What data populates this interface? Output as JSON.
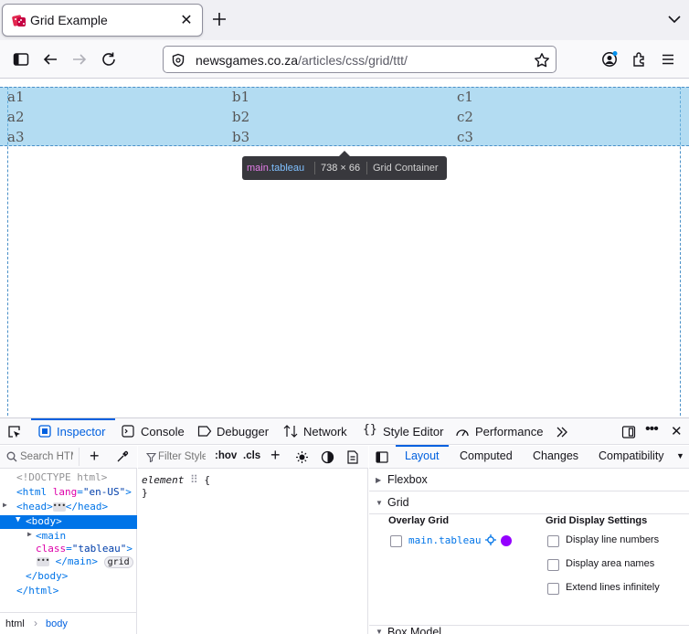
{
  "browser": {
    "tab_title": "Grid Example",
    "url_host": "newsgames.co.za",
    "url_path": "/articles/css/grid/ttt/"
  },
  "page": {
    "rows": [
      [
        "a1",
        "b1",
        "c1"
      ],
      [
        "a2",
        "b2",
        "c2"
      ],
      [
        "a3",
        "b3",
        "c3"
      ]
    ],
    "tooltip": {
      "tag": "main",
      "class": ".tableau",
      "dimensions": "738 × 66",
      "kind": "Grid Container"
    }
  },
  "devtools": {
    "tabs": [
      "Inspector",
      "Console",
      "Debugger",
      "Network",
      "Style Editor",
      "Performance"
    ],
    "search_placeholder": "Search HTML",
    "filter_placeholder": "Filter Styles",
    "hov_label": ":hov",
    "cls_label": ".cls",
    "markup": {
      "doctype": "<!DOCTYPE html>",
      "html_open_tag": "<html ",
      "html_lang_attr": "lang",
      "html_lang_val": "\"en-US\"",
      "html_close_bracket": ">",
      "head_open": "<head>",
      "head_close": "</head>",
      "body_open": "<body>",
      "main_open": "<main",
      "main_class_attr": "class",
      "main_class_val": "\"tableau\"",
      "main_close": "</main>",
      "main_badge": "grid",
      "body_close": "</body>",
      "html_close": "</html>"
    },
    "breadcrumbs": [
      "html",
      "body"
    ],
    "rules": {
      "selector": "element",
      "open": "{",
      "close": "}"
    },
    "layout_tabs": [
      "Layout",
      "Computed",
      "Changes",
      "Compatibility"
    ],
    "sections": {
      "flexbox": "Flexbox",
      "grid": "Grid",
      "box_model": "Box Model"
    },
    "grid_panel": {
      "overlay_heading": "Overlay Grid",
      "overlay_item": "main.tableau",
      "overlay_color": "#9400ff",
      "settings_heading": "Grid Display Settings",
      "settings": [
        "Display line numbers",
        "Display area names",
        "Extend lines infinitely"
      ]
    }
  }
}
